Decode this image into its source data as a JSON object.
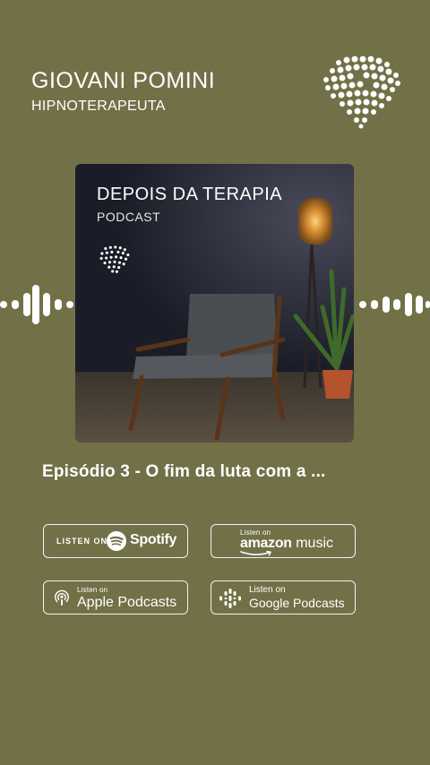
{
  "header": {
    "name": "GIOVANI POMINI",
    "role": "HIPNOTERAPEUTA"
  },
  "cover": {
    "title": "DEPOIS DA TERAPIA",
    "subtitle": "PODCAST"
  },
  "episode": {
    "title": "Episódio 3 - O fim da luta com a ..."
  },
  "platforms": {
    "spotify": {
      "listen": "LISTEN ON",
      "name": "Spotify"
    },
    "amazon": {
      "listen": "Listen on",
      "name_bold": "amazon",
      "name_rest": " music"
    },
    "apple": {
      "listen": "Listen on",
      "name": "Apple Podcasts"
    },
    "google": {
      "listen": "Listen on",
      "name": "Google Podcasts"
    }
  },
  "icons": {
    "brand": "dotted-brain-heart-icon",
    "waveform": "audio-waveform-icon",
    "spotify": "spotify-icon",
    "amazon": "amazon-smile-icon",
    "apple": "apple-podcasts-icon",
    "google": "google-podcasts-icon"
  },
  "colors": {
    "background": "#727047",
    "text": "#ffffff",
    "badge_border": "#f2f2f2"
  }
}
